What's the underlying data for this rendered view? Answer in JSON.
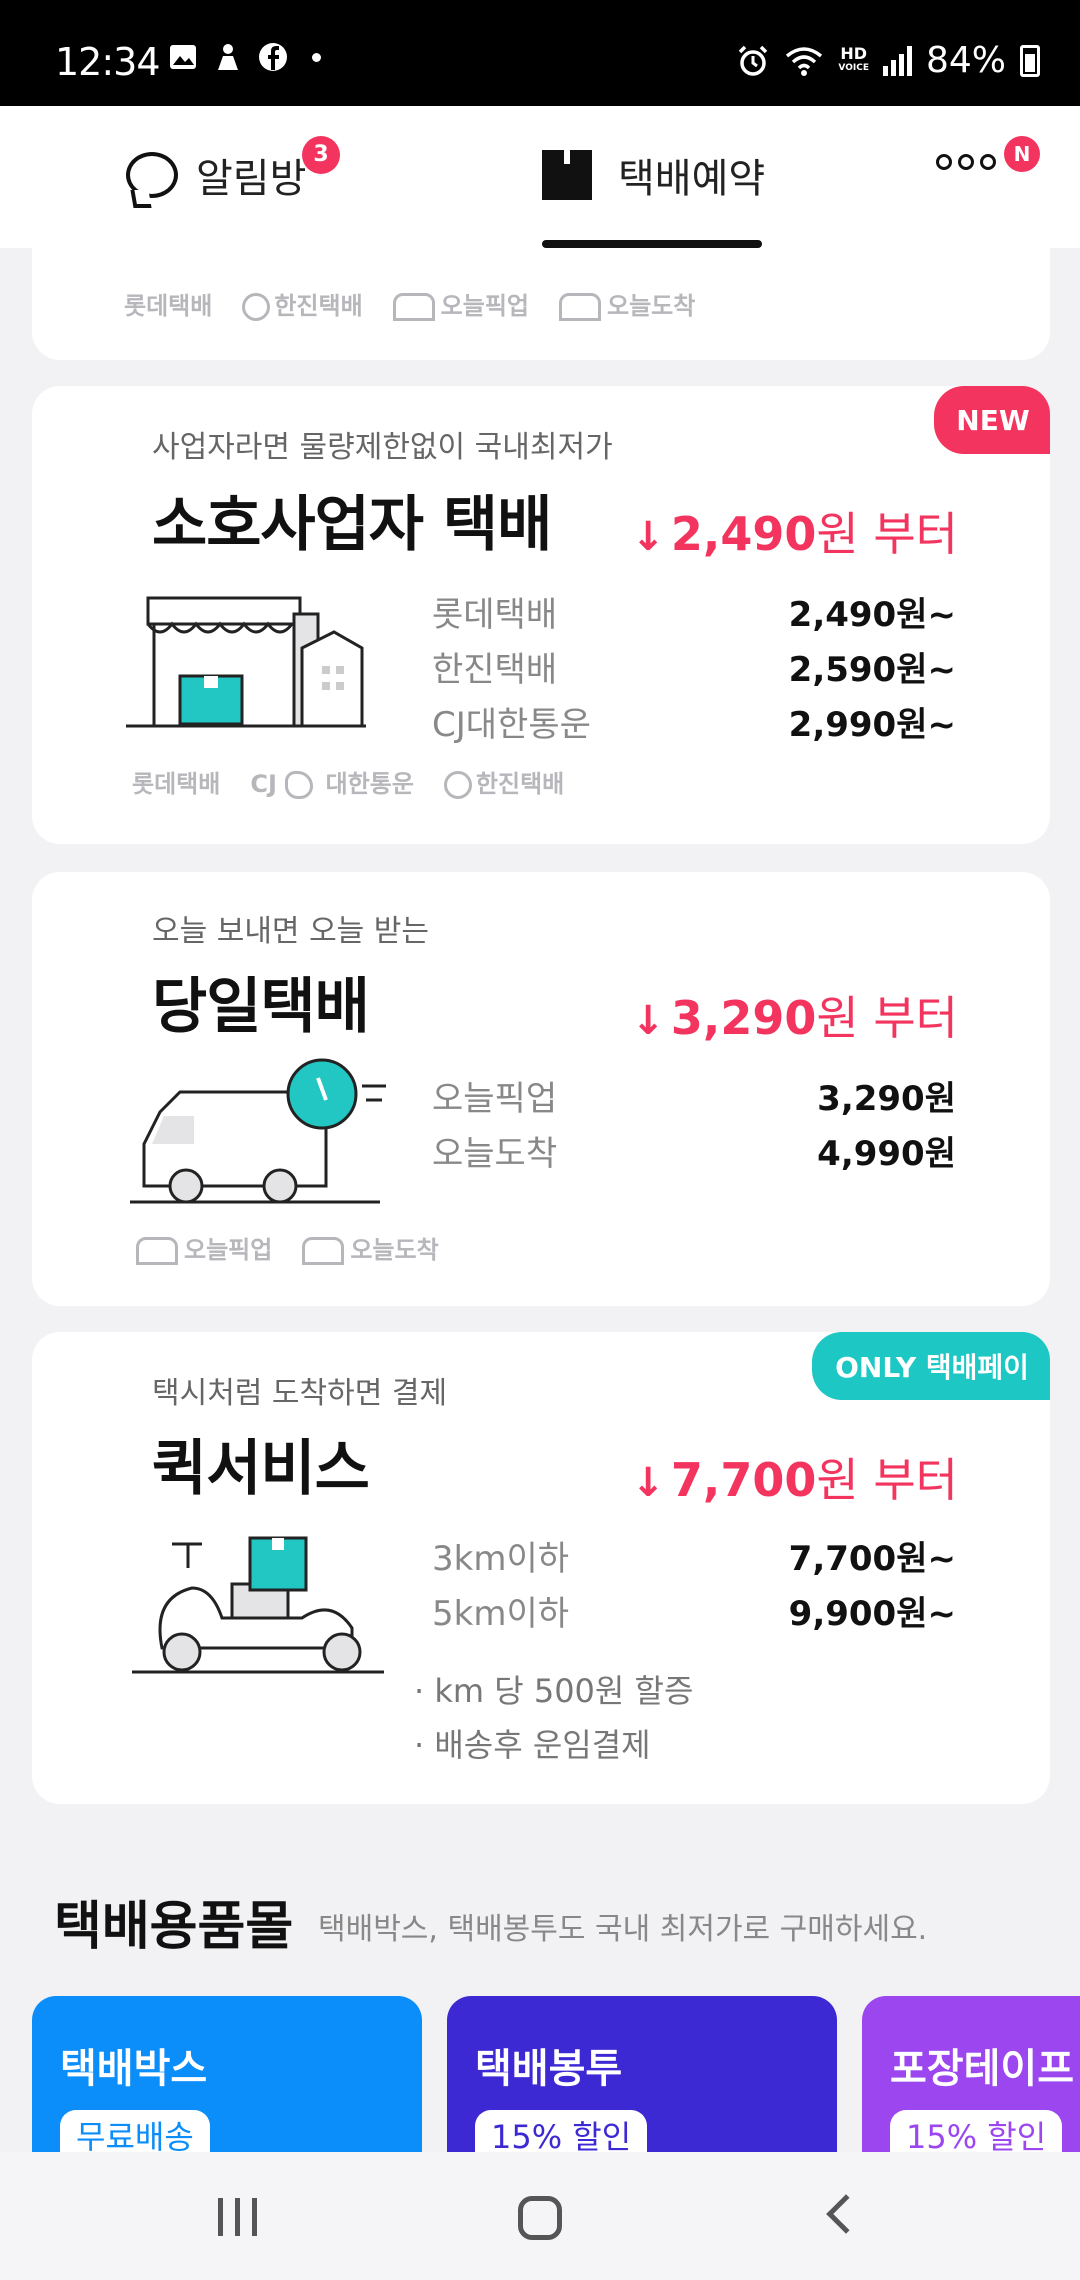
{
  "status_bar": {
    "time": "12:34",
    "battery": "84%",
    "hd_label": "HD",
    "voice_label": "VOICE"
  },
  "header": {
    "tabs": [
      {
        "label": "알림방",
        "badge": "3"
      },
      {
        "label": "택배예약"
      },
      {
        "label": "",
        "badge": "N"
      }
    ]
  },
  "top_card": {
    "carriers": [
      "롯데택배",
      "한진택배",
      "오늘픽업",
      "오늘도착"
    ]
  },
  "soho": {
    "corner_label": "NEW",
    "subtitle": "사업자라면 물량제한없이 국내최저가",
    "title": "소호사업자 택배",
    "price_from_arrow": "↓",
    "price_from_value": "2,490",
    "price_from_unit": "원 부터",
    "rows": [
      {
        "label": "롯데택배",
        "value": "2,490원~"
      },
      {
        "label": "한진택배",
        "value": "2,590원~"
      },
      {
        "label": "CJ대한통운",
        "value": "2,990원~"
      }
    ],
    "carriers": [
      "롯데택배",
      "CJ",
      "대한통운",
      "한진택배"
    ]
  },
  "sameday": {
    "subtitle": "오늘 보내면 오늘 받는",
    "title": "당일택배",
    "price_from_arrow": "↓",
    "price_from_value": "3,290",
    "price_from_unit": "원 부터",
    "rows": [
      {
        "label": "오늘픽업",
        "value": "3,290원"
      },
      {
        "label": "오늘도착",
        "value": "4,990원"
      }
    ],
    "carriers": [
      "오늘픽업",
      "오늘도착"
    ]
  },
  "quick": {
    "corner_label": "ONLY 택배페이",
    "subtitle": "택시처럼 도착하면 결제",
    "title": "퀵서비스",
    "price_from_arrow": "↓",
    "price_from_value": "7,700",
    "price_from_unit": "원 부터",
    "rows": [
      {
        "label": "3km이하",
        "value": "7,700원~"
      },
      {
        "label": "5km이하",
        "value": "9,900원~"
      }
    ],
    "notes": [
      "· km 당 500원 할증",
      "· 배송후 운임결제"
    ]
  },
  "shop": {
    "title": "택배용품몰",
    "subtitle": "택배박스, 택배봉투도 국내 최저가로 구매하세요.",
    "tiles": [
      {
        "name": "택배박스",
        "badge": "무료배송",
        "color": "#0b8dfa"
      },
      {
        "name": "택배봉투",
        "badge": "15% 할인",
        "color": "#3d29d4"
      },
      {
        "name": "포장테이프",
        "badge": "15% 할인",
        "color": "#9b46ef"
      }
    ]
  },
  "colors": {
    "accent": "#f2345e",
    "teal": "#1dc7c4"
  }
}
